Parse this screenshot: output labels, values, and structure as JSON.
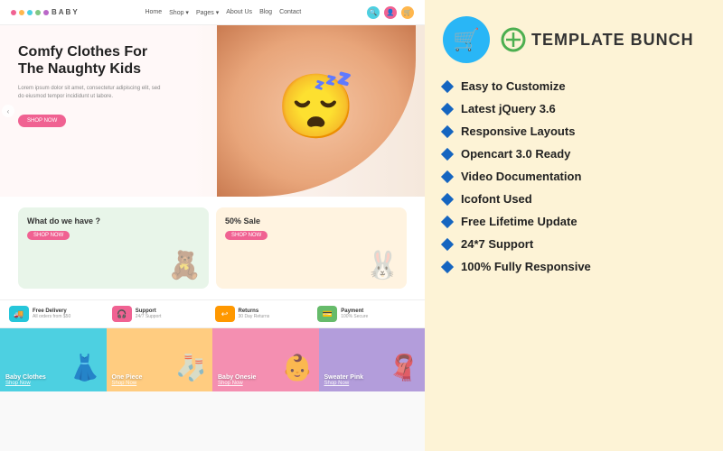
{
  "site": {
    "logo_dots": [
      "#f06292",
      "#ffb74d",
      "#4dd0e1",
      "#81c784",
      "#ba68c8"
    ],
    "logo_text": "BABY",
    "nav": [
      "Home",
      "Shop ▾",
      "Pages ▾",
      "About Us",
      "Blog",
      "Contact"
    ],
    "header_icons": [
      {
        "color": "#4dd0e1",
        "icon": "🔍"
      },
      {
        "color": "#f06292",
        "icon": "👤"
      },
      {
        "color": "#ffb74d",
        "icon": "🛒"
      }
    ]
  },
  "hero": {
    "title_line1": "Comfy Clothes For",
    "title_line2": "The Naughty Kids",
    "description": "Lorem ipsum dolor sit amet, consectetur adipiscing elit,\nsed do eiusmod tempor incididunt ut labore.",
    "button_label": "SHOP NOW",
    "arrow": "‹"
  },
  "promo_cards": [
    {
      "label": "What do we have ?",
      "btn": "SHOP NOW",
      "emoji": "🧸"
    },
    {
      "label": "50% Sale",
      "btn": "SHOP NOW",
      "emoji": "🐰"
    }
  ],
  "features_bar": [
    {
      "icon": "🚚",
      "color": "cyan",
      "main": "Free Delivery",
      "sub": "All orders from $50"
    },
    {
      "icon": "🎧",
      "color": "pink",
      "main": "Support",
      "sub": "24/7 Support"
    },
    {
      "icon": "↩",
      "color": "orange",
      "main": "Returns",
      "sub": "30 Day Returns"
    },
    {
      "icon": "💳",
      "color": "green",
      "main": "Payment",
      "sub": "100% Secure"
    }
  ],
  "products": [
    {
      "label": "Baby Clothes",
      "shop": "Shop Now",
      "emoji": "👗"
    },
    {
      "label": "One Piece",
      "shop": "Shop Now",
      "emoji": "🧦"
    },
    {
      "label": "Baby Onesie",
      "shop": "Shop Now",
      "emoji": "👶"
    },
    {
      "label": "Sweater Pink",
      "shop": "Shop Now",
      "emoji": "🧣"
    }
  ],
  "right_panel": {
    "cart_icon": "🛒",
    "brand_icon": "⟳",
    "brand_name": "TEMPLATE BUNCH",
    "features": [
      "Easy to Customize",
      "Latest jQuery 3.6",
      "Responsive Layouts",
      "Opencart 3.0 Ready",
      "Video Documentation",
      "Icofont Used",
      "Free Lifetime Update",
      "24*7 Support",
      "100% Fully Responsive"
    ]
  }
}
